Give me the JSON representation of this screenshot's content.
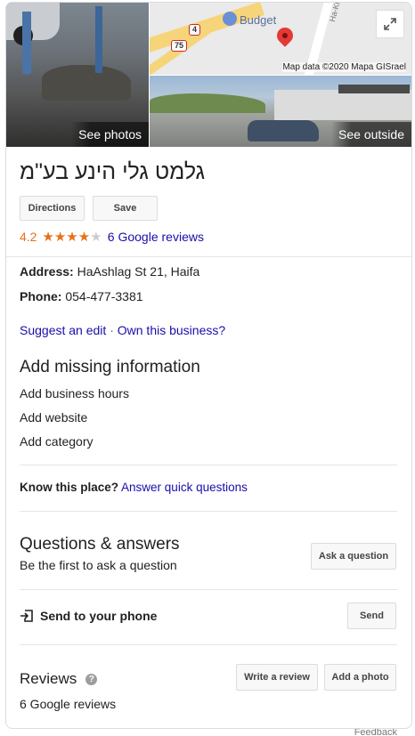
{
  "photos": {
    "see_photos": "See photos",
    "see_outside": "See outside",
    "map": {
      "road_4": "4",
      "road_75": "75",
      "budget_label": "Budget",
      "street_label": "Ha-Kherm",
      "attribution": "Map data ©2020 Mapa GISrael"
    }
  },
  "business": {
    "name": "גלמט גלי הינע בע\"מ"
  },
  "actions": {
    "directions": "Directions",
    "save": "Save"
  },
  "rating": {
    "value": "4.2",
    "stars_filled": 4,
    "stars_total": 5,
    "reviews_link": "6 Google reviews"
  },
  "details": {
    "address_label": "Address:",
    "address_value": "HaAshlag St 21, Haifa",
    "phone_label": "Phone:",
    "phone_value": "054-477-3381"
  },
  "edit_links": {
    "suggest_edit": "Suggest an edit",
    "separator": "·",
    "own_business": "Own this business?"
  },
  "missing": {
    "heading": "Add missing information",
    "hours": "Add business hours",
    "website": "Add website",
    "category": "Add category"
  },
  "know": {
    "label": "Know this place?",
    "link": "Answer quick questions"
  },
  "qa": {
    "heading": "Questions & answers",
    "link": "Be the first to ask a question",
    "button": "Ask a question"
  },
  "send": {
    "label": "Send to your phone",
    "button": "Send"
  },
  "reviews": {
    "heading": "Reviews",
    "link": "6 Google reviews",
    "write_button": "Write a review",
    "photo_button": "Add a photo"
  },
  "footer": {
    "feedback": "Feedback"
  }
}
